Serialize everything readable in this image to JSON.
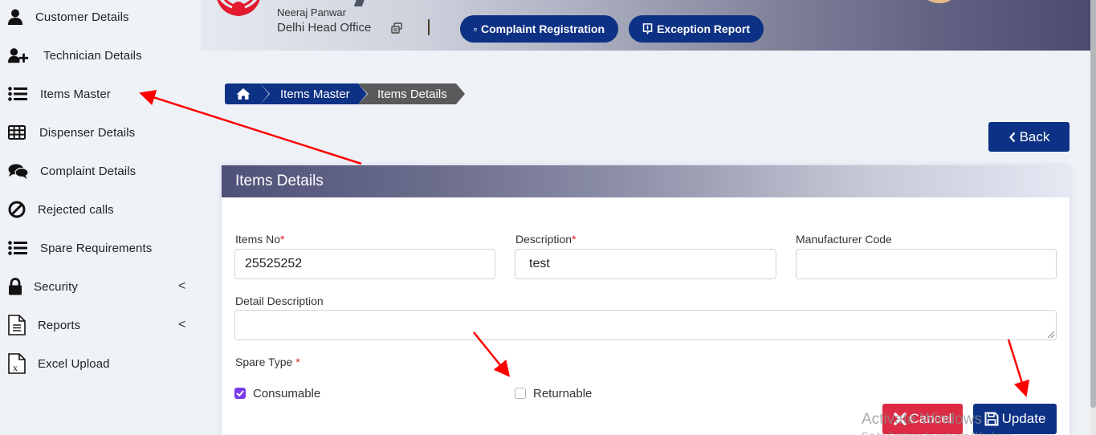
{
  "sidebar": {
    "items": [
      {
        "label": "Customer Details",
        "icon": "user-icon"
      },
      {
        "label": "Technician Details",
        "icon": "user-plus-icon"
      },
      {
        "label": "Items Master",
        "icon": "list-icon"
      },
      {
        "label": "Dispenser Details",
        "icon": "table-icon"
      },
      {
        "label": "Complaint Details",
        "icon": "comments-icon"
      },
      {
        "label": "Rejected calls",
        "icon": "ban-icon"
      },
      {
        "label": "Spare Requirements",
        "icon": "list-icon"
      },
      {
        "label": "Security",
        "icon": "lock-icon",
        "chevron": "<"
      },
      {
        "label": "Reports",
        "icon": "document-icon",
        "chevron": "<"
      },
      {
        "label": "Excel Upload",
        "icon": "excel-file-icon"
      }
    ]
  },
  "header": {
    "user_name": "Neeraj Panwar",
    "office": "Delhi Head Office",
    "buttons": {
      "complaint_registration": "Complaint Registration",
      "exception_report": "Exception Report"
    }
  },
  "breadcrumb": {
    "home_icon": "home-icon",
    "items": [
      "Items Master",
      "Items Details"
    ]
  },
  "back_button": {
    "label": "Back"
  },
  "card": {
    "title": "Items Details",
    "fields": {
      "items_no": {
        "label": "Items No",
        "required_mark": "*",
        "value": "25525252"
      },
      "description": {
        "label": "Description",
        "required_mark": "*",
        "value": "test"
      },
      "manufacturer_code": {
        "label": "Manufacturer Code",
        "value": ""
      },
      "detail_description": {
        "label": "Detail Description",
        "value": ""
      }
    },
    "spare_type": {
      "label": "Spare Type",
      "required_mark": "*",
      "options": [
        {
          "label": "Consumable",
          "checked": true
        },
        {
          "label": "Returnable",
          "checked": false
        }
      ]
    },
    "actions": {
      "cancel": "Cancel",
      "update": "Update"
    }
  },
  "watermark": {
    "line1": "Activate Windows",
    "line2": "Go to Settings to activate Windows."
  },
  "colors": {
    "primary": "#0d3184",
    "danger": "#dc2b43",
    "checkbox_checked": "#7c3aed",
    "breadcrumb_current": "#5a5a5a",
    "annotation_arrow": "#ff0000"
  }
}
